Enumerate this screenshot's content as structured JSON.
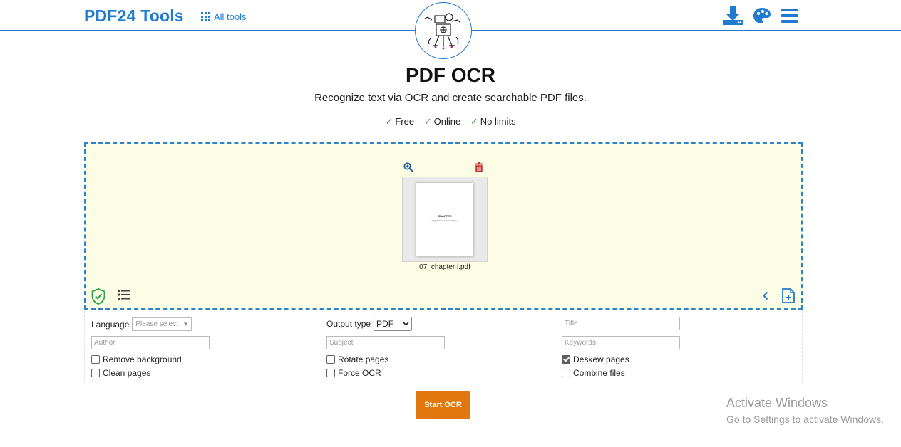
{
  "header": {
    "brand": "PDF24 Tools",
    "all_tools_label": "All tools"
  },
  "page": {
    "title": "PDF OCR",
    "subtitle": "Recognize text via OCR and create searchable PDF files.",
    "features": [
      "Free",
      "Online",
      "No limits"
    ]
  },
  "file": {
    "name": "07_chapter i.pdf",
    "preview_line1": "CHAPTER",
    "preview_line2": "Regulations and Guidelines"
  },
  "options": {
    "language_label": "Language",
    "language_placeholder": "Please select",
    "output_type_label": "Output type",
    "output_type_value": "PDF",
    "title_placeholder": "Title",
    "author_placeholder": "Author",
    "subject_placeholder": "Subject",
    "keywords_placeholder": "Keywords",
    "remove_background": "Remove background",
    "rotate_pages": "Rotate pages",
    "deskew_pages": "Deskew pages",
    "clean_pages": "Clean pages",
    "force_ocr": "Force OCR",
    "combine_files": "Combine files",
    "deskew_checked": true
  },
  "actions": {
    "start_label": "Start OCR"
  },
  "watermark": {
    "line1": "Activate Windows",
    "line2": "Go to Settings to activate Windows."
  },
  "colors": {
    "brand_blue": "#1f7bd0",
    "accent_orange": "#e0780d",
    "dropzone_bg": "#fdfce4",
    "check_green": "#3a9a3a"
  }
}
